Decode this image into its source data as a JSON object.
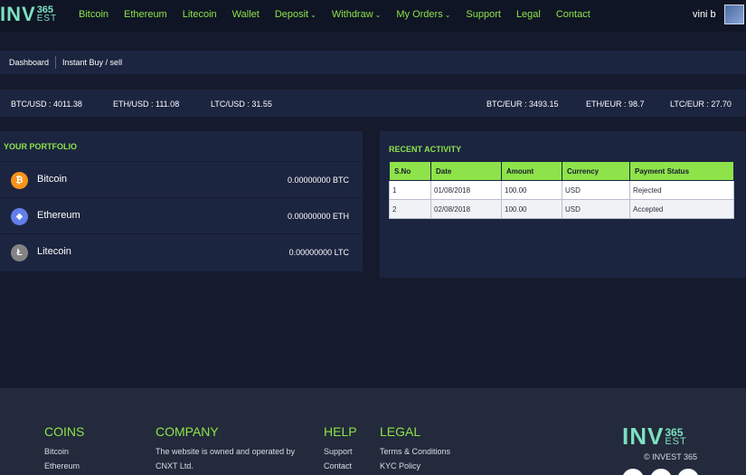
{
  "brand": {
    "inv": "INV",
    "num": "365",
    "est": "EST"
  },
  "nav": {
    "links": [
      "Bitcoin",
      "Ethereum",
      "Litecoin",
      "Wallet"
    ],
    "deposit": "Deposit",
    "withdraw": "Withdraw",
    "orders": "My Orders",
    "links2": [
      "Support",
      "Legal",
      "Contact"
    ],
    "user": "vini b"
  },
  "breadcrumb": {
    "home": "Dashboard",
    "current": "Instant Buy / sell"
  },
  "ticker": {
    "btc_usd": "BTC/USD : 4011.38",
    "eth_usd": "ETH/USD : 111.08",
    "ltc_usd": "LTC/USD : 31.55",
    "btc_eur": "BTC/EUR : 3493.15",
    "eth_eur": "ETH/EUR : 98.7",
    "ltc_eur": "LTC/EUR : 27.70"
  },
  "portfolio": {
    "title": "YOUR PORTFOLIO",
    "coins": [
      {
        "name": "Bitcoin",
        "amount": "0.00000000 BTC",
        "icon": "bitcoin-icon",
        "color": "#f7931a"
      },
      {
        "name": "Ethereum",
        "amount": "0.00000000 ETH",
        "icon": "ethereum-icon",
        "color": "#627eea"
      },
      {
        "name": "Litecoin",
        "amount": "0.00000000 LTC",
        "icon": "litecoin-icon",
        "color": "#838383"
      }
    ]
  },
  "activity": {
    "title": "RECENT ACTIVITY",
    "headers": [
      "S.No",
      "Date",
      "Amount",
      "Currency",
      "Payment Status"
    ],
    "rows": [
      [
        "1",
        "01/08/2018",
        "100.00",
        "USD",
        "Rejected"
      ],
      [
        "2",
        "02/08/2018",
        "100.00",
        "USD",
        "Accepted"
      ]
    ]
  },
  "footer": {
    "coins": {
      "title": "COINS",
      "items": [
        "Bitcoin",
        "Ethereum"
      ]
    },
    "company": {
      "title": "COMPANY",
      "lines": [
        "The website is owned and operated by",
        "CNXT Ltd."
      ]
    },
    "help": {
      "title": "HELP",
      "items": [
        "Support",
        "Contact"
      ]
    },
    "legal": {
      "title": "LEGAL",
      "items": [
        "Terms & Conditions",
        "KYC Policy"
      ]
    },
    "copyright": "© INVEST 365"
  },
  "colors": {
    "accent": "#8ee34a",
    "panel": "#1c2540",
    "background": "#151b2d",
    "logo": "#7ee0c0"
  }
}
